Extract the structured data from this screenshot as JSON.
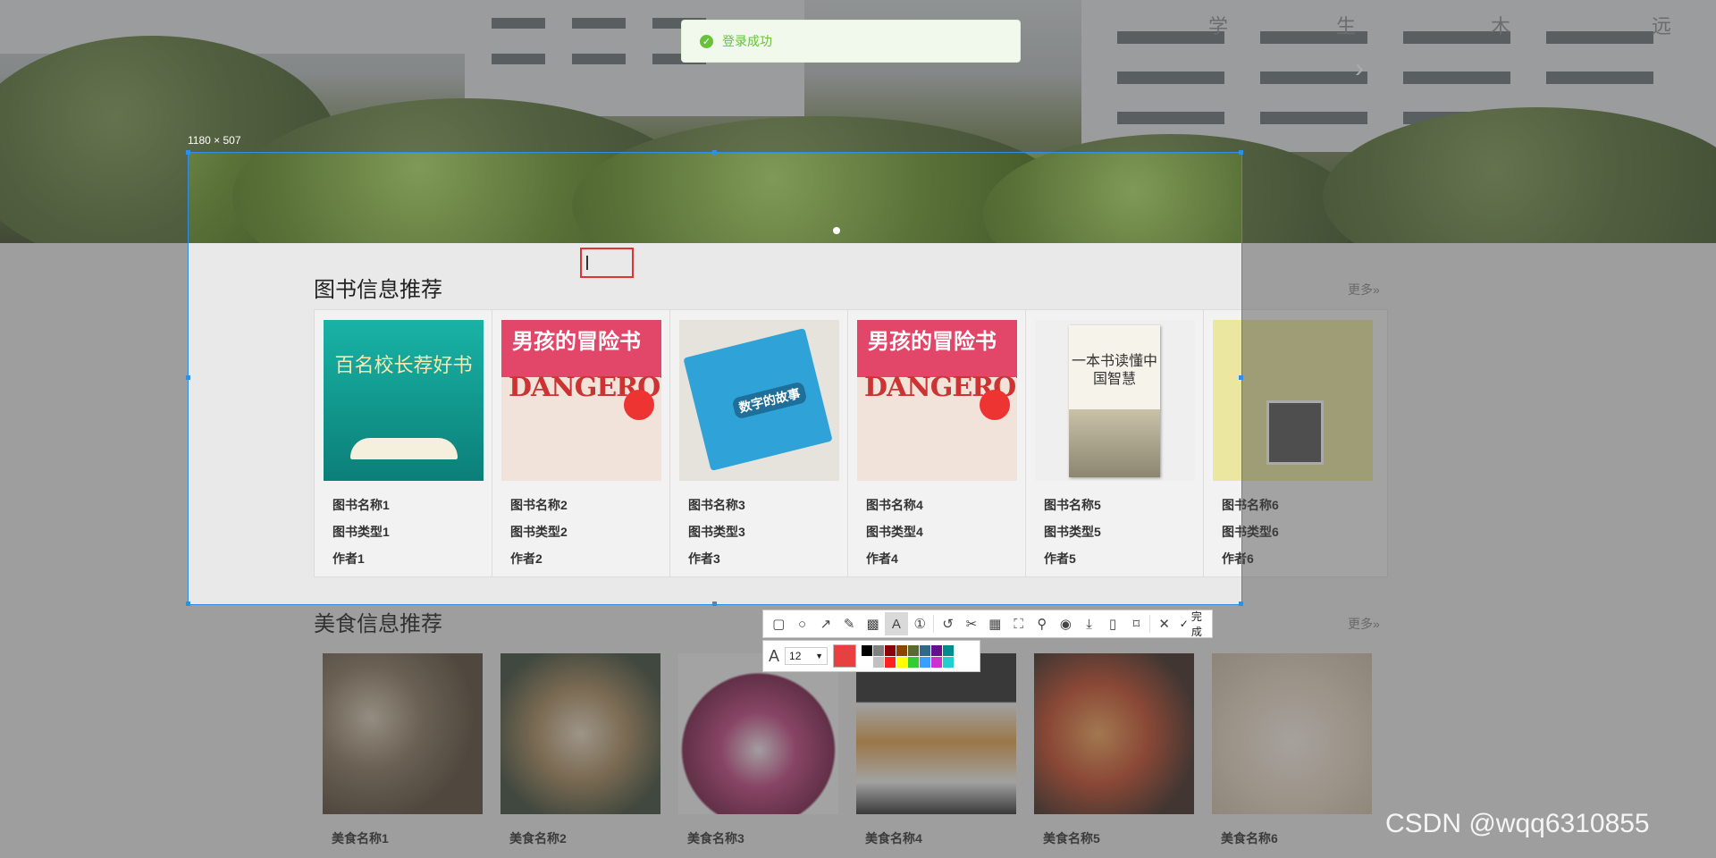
{
  "banner": {
    "slogan_chars": [
      "学",
      "生",
      "木",
      "远"
    ]
  },
  "toast": {
    "message": "登录成功"
  },
  "screenshot_tool": {
    "size_label": "1180 × 507",
    "done_label": "完成",
    "font_size": "12",
    "current_color": "#e84040",
    "palette": [
      "#000000",
      "#808080",
      "#8b0000",
      "#8b4500",
      "#556b2f",
      "#2e6b8b",
      "#6a0d8b",
      "#008b8b",
      "#ffffff",
      "#c0c0c0",
      "#ff2020",
      "#ffff00",
      "#33cc33",
      "#3aa0ff",
      "#cc33cc",
      "#20d0d0"
    ]
  },
  "books": {
    "title": "图书信息推荐",
    "more": "更多»",
    "items": [
      {
        "name": "图书名称1",
        "type": "图书类型1",
        "author": "作者1",
        "cover_text": "百名校长荐好书"
      },
      {
        "name": "图书名称2",
        "type": "图书类型2",
        "author": "作者2",
        "cover_text": "男孩的冒险书",
        "cover_big": "DANGEROUS"
      },
      {
        "name": "图书名称3",
        "type": "图书类型3",
        "author": "作者3",
        "cover_text": "数字的故事"
      },
      {
        "name": "图书名称4",
        "type": "图书类型4",
        "author": "作者4",
        "cover_text": "男孩的冒险书",
        "cover_big": "DANGEROUS"
      },
      {
        "name": "图书名称5",
        "type": "图书类型5",
        "author": "作者5",
        "cover_text": "一本书读懂中国智慧"
      },
      {
        "name": "图书名称6",
        "type": "图书类型6",
        "author": "作者6"
      }
    ]
  },
  "foods": {
    "title": "美食信息推荐",
    "more": "更多»",
    "items": [
      {
        "name": "美食名称1",
        "color": "#6b5c4a"
      },
      {
        "name": "美食名称2",
        "color": "#7a6a4e"
      },
      {
        "name": "美食名称3",
        "color": "#8a3f6a"
      },
      {
        "name": "美食名称4",
        "color": "#c98a3a"
      },
      {
        "name": "美食名称5",
        "color": "#a8482e"
      },
      {
        "name": "美食名称6",
        "color": "#e8e0d6"
      }
    ]
  },
  "watermark": "CSDN @wqq6310855"
}
